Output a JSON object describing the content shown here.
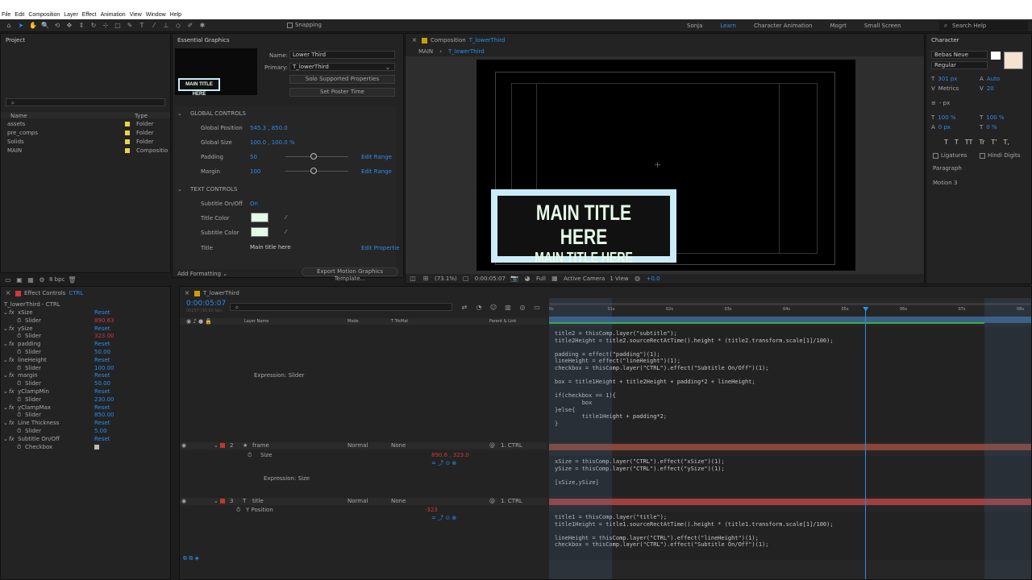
{
  "menu": [
    "File",
    "Edit",
    "Composition",
    "Layer",
    "Effect",
    "Animation",
    "View",
    "Window",
    "Help"
  ],
  "toolbar": {
    "snapping": "Snapping",
    "workspaces": [
      "Sonja",
      "Learn",
      "Character Animation",
      "Mogrt",
      "Small Screen"
    ],
    "active_workspace": "Learn",
    "search_placeholder": "Search Help"
  },
  "project": {
    "title": "Project",
    "columns": [
      "Name",
      "Type"
    ],
    "items": [
      {
        "name": "assets",
        "type": "Folder",
        "color": "#e8d542"
      },
      {
        "name": "pre_comps",
        "type": "Folder",
        "color": "#e8d542"
      },
      {
        "name": "Solids",
        "type": "Folder",
        "color": "#e8d542"
      },
      {
        "name": "MAIN",
        "type": "Compositio",
        "color": "#e8d542"
      }
    ],
    "footer": "8 bpc"
  },
  "essential": {
    "title": "Essential Graphics",
    "thumb_text": "MAIN TITLE HERE",
    "name_label": "Name:",
    "name_value": "Lower Third",
    "primary_label": "Primary:",
    "primary_value": "T_lowerThird",
    "solo_btn": "Solo Supported Properties",
    "poster_btn": "Set Poster Time",
    "global_header": "GLOBAL CONTROLS",
    "global": [
      {
        "label": "Global Position",
        "value": "545.3 , 850.0"
      },
      {
        "label": "Global Size",
        "value": "100.0 , 100.0 %"
      },
      {
        "label": "Padding",
        "value": "50",
        "slider": 0.45,
        "link": "Edit Range"
      },
      {
        "label": "Margin",
        "value": "100",
        "slider": 0.45,
        "link": "Edit Range"
      }
    ],
    "text_header": "TEXT CONTROLS",
    "subtitle_toggle_label": "Subtitle On/Off",
    "subtitle_toggle_value": "On",
    "title_color_label": "Title Color",
    "subtitle_color_label": "Subtitle Color",
    "swatch_color": "#e3fbe9",
    "title_label": "Title",
    "title_value": "Main title here",
    "title_link": "Edit Propertie",
    "add_formatting": "Add Formatting",
    "export_btn": "Export Motion Graphics Template..."
  },
  "composition": {
    "tab": "Composition",
    "tab_name": "T_lowerThird",
    "breadcrumb_main": "MAIN",
    "breadcrumb_current": "T_lowerThird",
    "lower_third_title": "MAIN TITLE HERE",
    "lower_third_subtitle": "MAIN TITLE HERE",
    "lt_bg": "#c9ecf7",
    "lt_inner": "#111111",
    "lt_text": "#e6fbe8",
    "zoom": "(73.1%)",
    "timecode": "0:00:05:07",
    "resolution": "Full",
    "camera": "Active Camera",
    "views": "1 View",
    "exposure": "+0.0"
  },
  "character": {
    "title": "Character",
    "font": "Bebas Neue",
    "style": "Regular",
    "size": "301 px",
    "leading": "Auto",
    "kerning": "Metrics",
    "tracking": "20",
    "stroke": "- px",
    "vscale": "100 %",
    "hscale": "100 %",
    "baseline": "0 px",
    "tsume": "0 %",
    "styles": [
      "T",
      "T",
      "TT",
      "Tr",
      "T'",
      "T,"
    ],
    "ligatures": "Ligatures",
    "hindi": "Hindi Digits",
    "paragraph": "Paragraph",
    "motion": "Motion 3"
  },
  "effects": {
    "tab": "Effect Controls",
    "tab_layer": "CTRL",
    "layer_path": "T_lowerThird - CTRL",
    "items": [
      {
        "name": "xSize",
        "reset": "Reset",
        "slider_label": "Slider",
        "slider_value": "890.63",
        "red": true
      },
      {
        "name": "ySize",
        "reset": "Reset",
        "slider_label": "Slider",
        "slider_value": "323.00",
        "red": true
      },
      {
        "name": "padding",
        "reset": "Reset",
        "slider_label": "Slider",
        "slider_value": "50.00",
        "red": false
      },
      {
        "name": "lineHeight",
        "reset": "Reset",
        "slider_label": "Slider",
        "slider_value": "100.00",
        "red": false
      },
      {
        "name": "margin",
        "reset": "Reset",
        "slider_label": "Slider",
        "slider_value": "50.00",
        "red": false
      },
      {
        "name": "yClampMin",
        "reset": "Reset",
        "slider_label": "Slider",
        "slider_value": "230.00",
        "red": false
      },
      {
        "name": "yClampMax",
        "reset": "Reset",
        "slider_label": "Slider",
        "slider_value": "850.00",
        "red": false
      },
      {
        "name": "Line Thickness",
        "reset": "Reset",
        "slider_label": "Slider",
        "slider_value": "5.00",
        "red": false
      },
      {
        "name": "Subtitle On/Off",
        "reset": "Reset",
        "slider_label": "Checkbox",
        "slider_value": "",
        "red": false
      }
    ]
  },
  "timeline": {
    "tab": "T_lowerThird",
    "timecode": "0:00:05:07",
    "frames": "00157 (30.00 fps)",
    "columns": [
      "Layer Name",
      "Mode",
      "T TrkMat",
      "Parent & Link"
    ],
    "ruler": [
      "0s",
      "01s",
      "02s",
      "03s",
      "04s",
      "05s",
      "06s",
      "07s",
      "08s"
    ],
    "playhead_fraction": 0.656,
    "expression_slider": "Expression: Slider",
    "layers": [
      {
        "num": "2",
        "name": "frame",
        "mode": "Normal",
        "trkmat": "None",
        "parent": "1. CTRL",
        "prop": "Size",
        "value": "890.6 , 323.0",
        "expr": "Expression: Size"
      },
      {
        "num": "3",
        "name": "title",
        "mode": "Normal",
        "trkmat": "None",
        "parent": "1. CTRL",
        "prop": "Y Position",
        "value": "-323",
        "expr": ""
      }
    ],
    "code1": "title2 = thisComp.layer(\"subtitle\");\ntitle2Height = title2.sourceRectAtTime().height * (title2.transform.scale[1]/100);\n\npadding = effect(\"padding\")(1);\nlineHeight = effect(\"lineHeight\")(1);\ncheckbox = thisComp.layer(\"CTRL\").effect(\"Subtitle On/Off\")(1);\n\nbox = title1Height + title2Height + padding*2 + lineHeight;\n\nif(checkbox == 1){\n        box\n}else{\n        title1Height + padding*2;\n}",
    "code2": "xSize = thisComp.layer(\"CTRL\").effect(\"xSize\")(1);\nySize = thisComp.layer(\"CTRL\").effect(\"ySize\")(1);\n\n[xSize,ySize]",
    "code3": "title1 = thisComp.layer(\"title\");\ntitle1Height = title1.sourceRectAtTime().height * (title1.transform.scale[1]/100);\n\nlineHeight = thisComp.layer(\"CTRL\").effect(\"lineHeight\")(1);\ncheckbox = thisComp.layer(\"CTRL\").effect(\"Subtitle On/Off\")(1);"
  }
}
